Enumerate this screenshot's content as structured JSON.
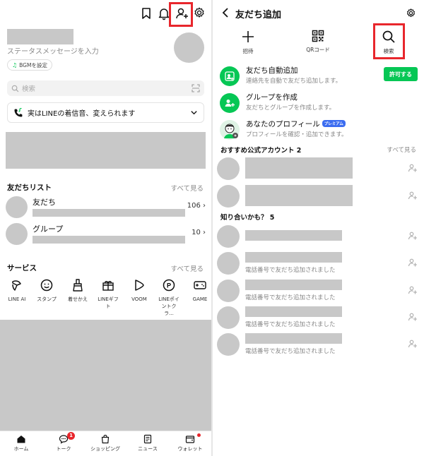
{
  "left": {
    "status_message_placeholder": "ステータスメッセージを入力",
    "bgm_chip": "BGMを設定",
    "search_placeholder": "検索",
    "banner_text": "実はLINEの着信音、変えられます",
    "friend_list": {
      "title": "友だちリスト",
      "see_all": "すべて見る",
      "items": [
        {
          "label": "友だち",
          "count": "106"
        },
        {
          "label": "グループ",
          "count": "10"
        }
      ]
    },
    "services": {
      "title": "サービス",
      "see_all": "すべて見る",
      "items": [
        {
          "label": "LINE AI",
          "icon": "line-ai-icon"
        },
        {
          "label": "スタンプ",
          "icon": "sticker-icon"
        },
        {
          "label": "着せかえ",
          "icon": "theme-brush-icon"
        },
        {
          "label": "LINEギフト",
          "icon": "gift-icon"
        },
        {
          "label": "VOOM",
          "icon": "voom-icon"
        },
        {
          "label": "LINEポイントクラ...",
          "icon": "point-icon"
        },
        {
          "label": "GAME",
          "icon": "game-icon"
        }
      ]
    },
    "bottom_nav": [
      {
        "label": "ホーム",
        "icon": "home-icon"
      },
      {
        "label": "トーク",
        "icon": "chat-icon",
        "badge": "1"
      },
      {
        "label": "ショッピング",
        "icon": "shopping-bag-icon"
      },
      {
        "label": "ニュース",
        "icon": "news-icon"
      },
      {
        "label": "ウォレット",
        "icon": "wallet-icon"
      }
    ],
    "header_icons": [
      "bookmark-icon",
      "bell-icon",
      "add-friend-icon",
      "gear-icon"
    ]
  },
  "right": {
    "title": "友だち追加",
    "actions": [
      {
        "label": "招待",
        "icon": "plus-icon"
      },
      {
        "label": "QRコード",
        "icon": "qr-code-icon"
      },
      {
        "label": "検索",
        "icon": "search-icon"
      }
    ],
    "options": [
      {
        "title": "友だち自動追加",
        "subtitle": "連絡先を自動で友だち追加します。",
        "button": "許可する"
      },
      {
        "title": "グループを作成",
        "subtitle": "友だちとグループを作成します。"
      },
      {
        "title": "あなたのプロフィール",
        "badge": "プレミアム",
        "subtitle": "プロフィールを確認・追加できます。"
      }
    ],
    "recommended": {
      "title": "おすすめ公式アカウント 2",
      "see_all": "すべて見る"
    },
    "know": {
      "title": "知り合いかも？ 5",
      "items": [
        {
          "sub": ""
        },
        {
          "sub": "電話番号で友だち追加されました"
        },
        {
          "sub": "電話番号で友だち追加されました"
        },
        {
          "sub": "電話番号で友だち追加されました"
        },
        {
          "sub": "電話番号で友だち追加されました"
        }
      ]
    }
  },
  "colors": {
    "accent": "#06c755",
    "highlight": "#e8262c",
    "placeholder_gray": "#c8c8c8",
    "premium_badge": "#3b6cf0"
  }
}
